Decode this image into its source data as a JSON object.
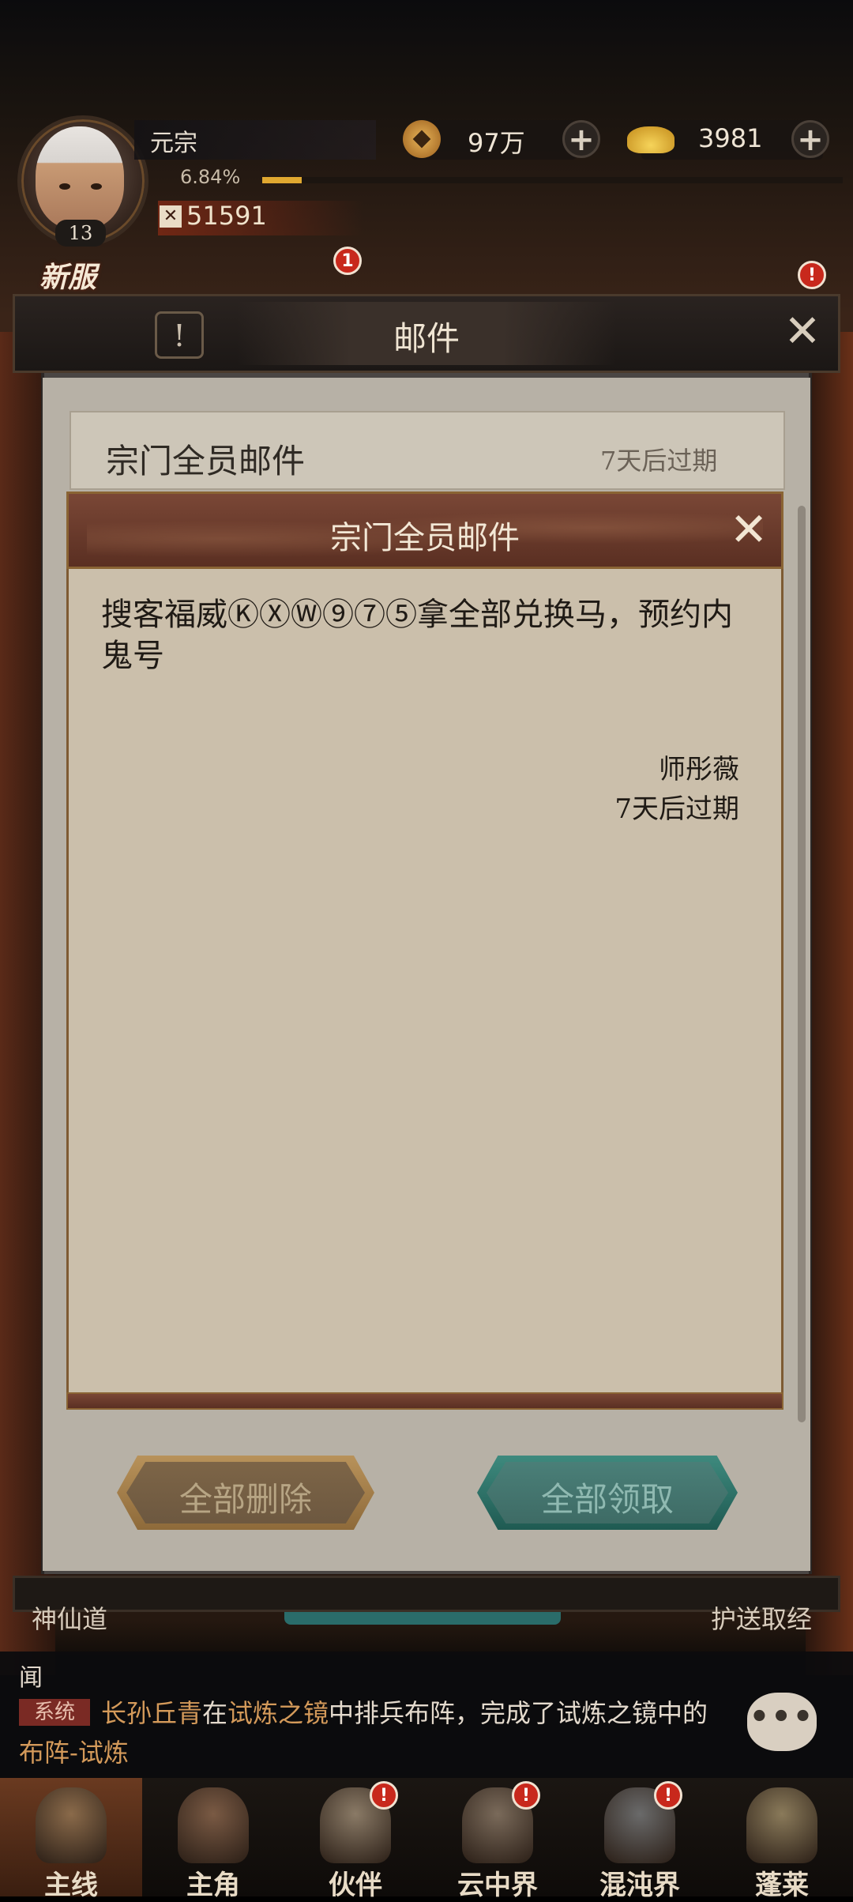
{
  "player": {
    "name": "元宗",
    "level": "13",
    "exp_percent": "6.84%",
    "exp_fraction": 0.0684,
    "power": "51591"
  },
  "resources": {
    "coins": "97万",
    "ingots": "3981"
  },
  "event_banner": {
    "label": "新服",
    "badge": "1"
  },
  "mail_window": {
    "title": "邮件",
    "list": [
      {
        "title": "宗门全员邮件",
        "expire": "7天后过期"
      }
    ],
    "delete_all": "全部删除",
    "claim_all": "全部领取"
  },
  "dialog": {
    "title": "宗门全员邮件",
    "message": "搜客福威ⓀⓍⓌ⑨⑦⑤拿全部兑换马，预约内鬼号",
    "sender": "师彤薇",
    "expire": "7天后过期"
  },
  "under_labels": {
    "left": "神仙道",
    "right": "护送取经"
  },
  "chat": {
    "channel": "闻",
    "tag": "系统",
    "segments": [
      {
        "text": "长孙丘青",
        "kind": "name"
      },
      {
        "text": "在",
        "kind": "plain"
      },
      {
        "text": "试炼之镜",
        "kind": "hl"
      },
      {
        "text": "中排兵布阵，完成了试炼之镜中的",
        "kind": "plain"
      },
      {
        "text": "布阵-试炼",
        "kind": "hl"
      }
    ]
  },
  "nav": {
    "items": [
      {
        "label": "主线",
        "active": true,
        "badge": ""
      },
      {
        "label": "主角",
        "active": false,
        "badge": ""
      },
      {
        "label": "伙伴",
        "active": false,
        "badge": "!"
      },
      {
        "label": "云中界",
        "active": false,
        "badge": "!"
      },
      {
        "label": "混沌界",
        "active": false,
        "badge": "!"
      },
      {
        "label": "蓬莱",
        "active": false,
        "badge": ""
      }
    ]
  },
  "colors": {
    "accent_gold": "#e0a830",
    "badge_red": "#c8281c",
    "claim_teal": "#3e8a7e",
    "delete_brown": "#8e6a3a"
  }
}
